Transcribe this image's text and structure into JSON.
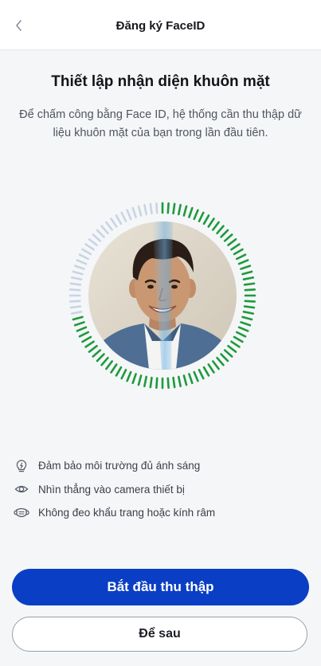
{
  "header": {
    "title": "Đăng ký FaceID",
    "back_icon": "chevron-left-icon"
  },
  "main": {
    "title": "Thiết lập nhận diện khuôn mặt",
    "description": "Để chấm công bằng Face ID, hệ thống cần thu thập dữ liệu khuôn mặt của bạn trong lần đầu tiên."
  },
  "scanner": {
    "progress": 0.72,
    "colors": {
      "done": "#1e9a3e",
      "pending": "#c9d4e4",
      "sweep": "#7fb0d8"
    }
  },
  "tips": [
    {
      "icon": "lightbulb-icon",
      "text": "Đảm bảo môi trường đủ ánh sáng"
    },
    {
      "icon": "eye-icon",
      "text": "Nhìn thẳng vào camera thiết bị"
    },
    {
      "icon": "mask-icon",
      "text": "Không đeo khẩu trang hoặc kính râm"
    }
  ],
  "buttons": {
    "start": "Bắt đầu thu thập",
    "later": "Để sau"
  },
  "colors": {
    "primary": "#0a3ec4",
    "success": "#1e9a3e"
  }
}
